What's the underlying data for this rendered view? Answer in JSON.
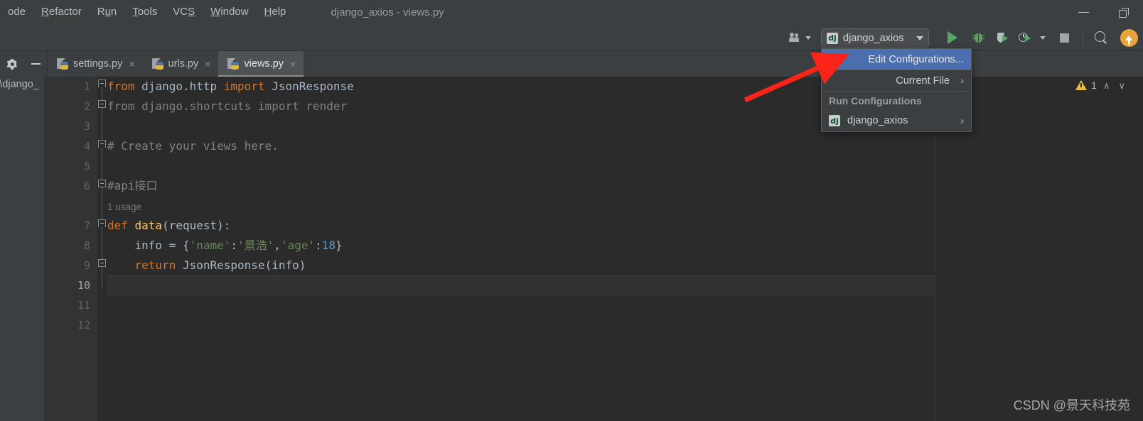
{
  "window": {
    "title": "django_axios - views.py",
    "minimize_label": "Minimize",
    "restore_label": "Restore"
  },
  "menubar": {
    "items": [
      {
        "label": "ode",
        "mnemonic": ""
      },
      {
        "label": "Refactor",
        "mnemonic": "R"
      },
      {
        "label": "Run",
        "mnemonic": "u"
      },
      {
        "label": "Tools",
        "mnemonic": "T"
      },
      {
        "label": "VCS",
        "mnemonic": "S"
      },
      {
        "label": "Window",
        "mnemonic": "W"
      },
      {
        "label": "Help",
        "mnemonic": "H"
      }
    ]
  },
  "toolbar": {
    "people_label": "people-icon",
    "run_config": {
      "name": "django_axios",
      "icon_text": "dj"
    },
    "actions": [
      {
        "name": "run",
        "label": "Run"
      },
      {
        "name": "debug",
        "label": "Debug"
      },
      {
        "name": "coverage",
        "label": "Run with Coverage"
      },
      {
        "name": "profile",
        "label": "Profile"
      },
      {
        "name": "stop",
        "label": "Stop"
      },
      {
        "name": "search",
        "label": "Search Everywhere"
      },
      {
        "name": "update",
        "label": "Update"
      }
    ]
  },
  "dropdown": {
    "edit_configurations": "Edit Configurations...",
    "current_file": "Current File",
    "section_header": "Run Configurations",
    "config_item": "django_axios",
    "config_icon_text": "dj",
    "submenu_arrow": "›",
    "highlight_color": "#4b6eaf"
  },
  "tabbar": {
    "gear_label": "Settings",
    "hide_label": "Hide",
    "tabs": [
      {
        "label": "settings.py",
        "active": false,
        "close": "×"
      },
      {
        "label": "urls.py",
        "active": false,
        "close": "×"
      },
      {
        "label": "views.py",
        "active": true,
        "close": "×"
      }
    ]
  },
  "project_panel": {
    "truncated_label": "s\\django_"
  },
  "editor": {
    "line_numbers": [
      "1",
      "2",
      "3",
      "4",
      "5",
      "6",
      "7",
      "8",
      "9",
      "10",
      "11",
      "12"
    ],
    "current_line": "10",
    "usage_hint": "1 usage",
    "lines": [
      {
        "n": 1,
        "tokens": [
          {
            "t": "from ",
            "c": "kw"
          },
          {
            "t": "django.http ",
            "c": "id"
          },
          {
            "t": "import ",
            "c": "kw"
          },
          {
            "t": "JsonResponse",
            "c": "cls"
          }
        ]
      },
      {
        "n": 2,
        "tokens": [
          {
            "t": "from django.shortcuts import render",
            "c": "gray"
          }
        ]
      },
      {
        "n": 3,
        "tokens": []
      },
      {
        "n": 4,
        "tokens": [
          {
            "t": "# Create your views here.",
            "c": "gray"
          }
        ]
      },
      {
        "n": 5,
        "tokens": []
      },
      {
        "n": 6,
        "tokens": [
          {
            "t": "#api接口",
            "c": "gray"
          }
        ]
      },
      {
        "n": 7,
        "tokens": [
          {
            "t": "def ",
            "c": "kw"
          },
          {
            "t": "data",
            "c": "fn"
          },
          {
            "t": "(request):",
            "c": "id"
          }
        ]
      },
      {
        "n": 8,
        "tokens": [
          {
            "t": "    info = {",
            "c": "id"
          },
          {
            "t": "'name'",
            "c": "str"
          },
          {
            "t": ":",
            "c": "id"
          },
          {
            "t": "'景浩'",
            "c": "str"
          },
          {
            "t": ",",
            "c": "id"
          },
          {
            "t": "'age'",
            "c": "str"
          },
          {
            "t": ":",
            "c": "id"
          },
          {
            "t": "18",
            "c": "num"
          },
          {
            "t": "}",
            "c": "id"
          }
        ]
      },
      {
        "n": 9,
        "tokens": [
          {
            "t": "    return ",
            "c": "kw"
          },
          {
            "t": "JsonResponse(info)",
            "c": "id"
          }
        ]
      },
      {
        "n": 10,
        "tokens": []
      },
      {
        "n": 11,
        "tokens": []
      },
      {
        "n": 12,
        "tokens": []
      }
    ]
  },
  "inspection": {
    "warning_count": "1",
    "prev_label": "∧",
    "next_label": "∨"
  },
  "watermark": {
    "text": "CSDN @景天科技苑"
  },
  "annotation": {
    "arrow_color": "#fc2419"
  }
}
